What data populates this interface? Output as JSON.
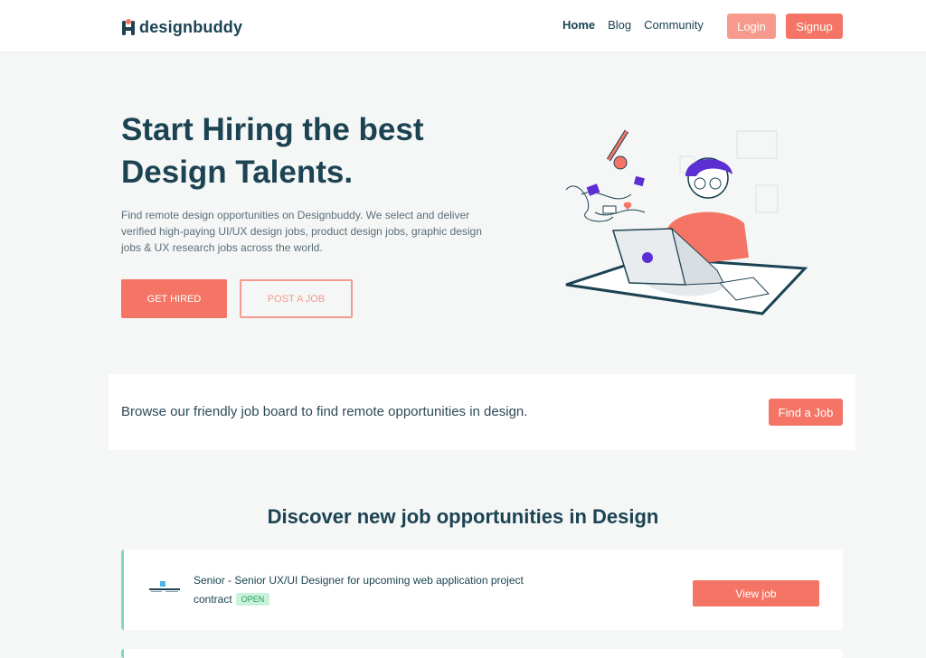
{
  "app": {
    "brand": "designbuddy",
    "accent": "#f47565",
    "accent_light": "#f69a8d",
    "dark_text": "#1b4352",
    "open_badge_color": "#7fdcae"
  },
  "nav": {
    "links": [
      {
        "label": "Home",
        "active": true
      },
      {
        "label": "Blog",
        "active": false
      },
      {
        "label": "Community",
        "active": false
      }
    ],
    "login_label": "Login",
    "signup_label": "Signup"
  },
  "hero": {
    "title_line1": "Start Hiring the best",
    "title_line2": "Design Talents.",
    "description": "Find remote design opportunities on Designbuddy. We select and deliver verified high-paying UI/UX design jobs, product design jobs, graphic design jobs & UX research jobs across the world.",
    "primary_cta": "GET HIRED",
    "secondary_cta": "POST A JOB"
  },
  "browse": {
    "text": "Browse our friendly job board to find remote opportunities in design.",
    "button_label": "Find a Job"
  },
  "jobs_section": {
    "title": "Discover new job opportunities in Design",
    "jobs": [
      {
        "title": "Senior - Senior UX/UI Designer for upcoming web application project",
        "type": "contract",
        "status": "OPEN",
        "button_label": "View job"
      }
    ]
  }
}
